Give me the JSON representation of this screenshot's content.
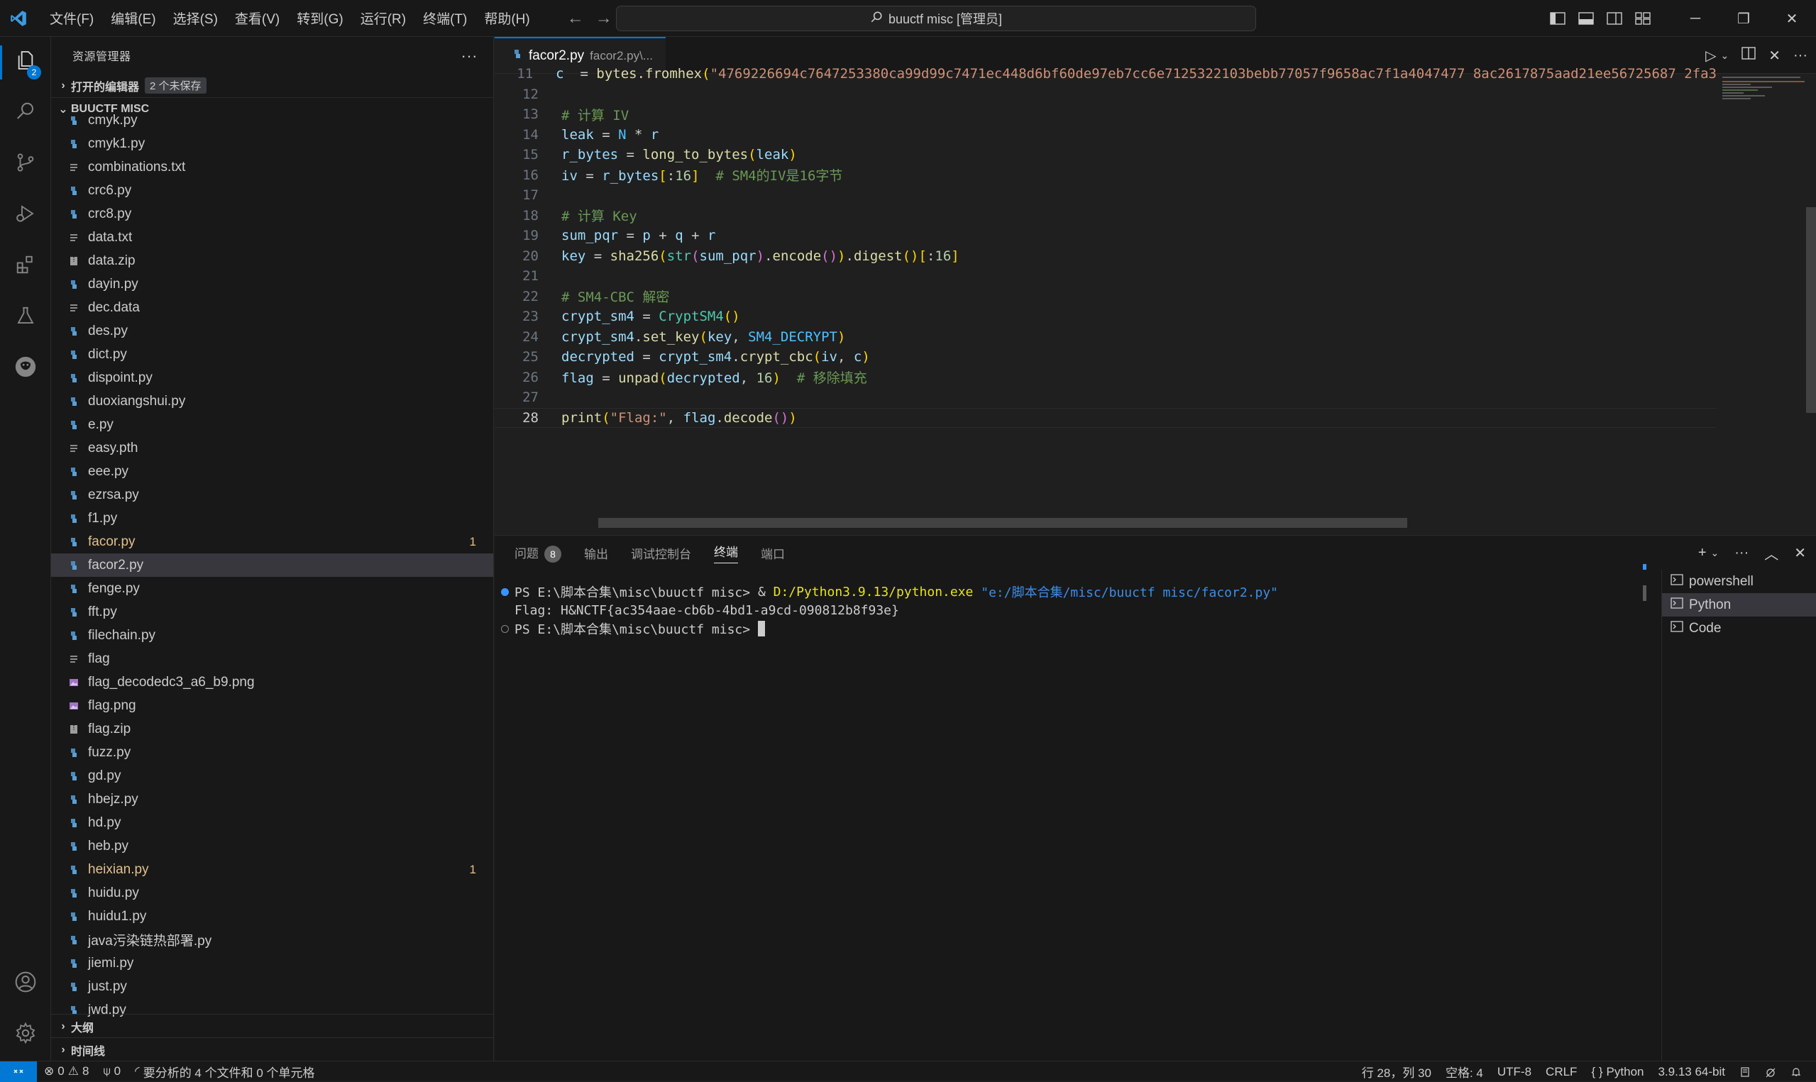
{
  "titlebar": {
    "menu": [
      "文件(F)",
      "编辑(E)",
      "选择(S)",
      "查看(V)",
      "转到(G)",
      "运行(R)",
      "终端(T)",
      "帮助(H)"
    ],
    "search": "buuctf misc [管理员]"
  },
  "activity": {
    "explorer_badge": "2"
  },
  "sidebar": {
    "title": "资源管理器",
    "open_editors": "打开的编辑器",
    "unsaved_badge": "2 个未保存",
    "folder": "BUUCTF MISC",
    "files": [
      {
        "name": "cmyk.py",
        "type": "py"
      },
      {
        "name": "cmyk1.py",
        "type": "py"
      },
      {
        "name": "combinations.txt",
        "type": "txt"
      },
      {
        "name": "crc6.py",
        "type": "py"
      },
      {
        "name": "crc8.py",
        "type": "py"
      },
      {
        "name": "data.txt",
        "type": "txt"
      },
      {
        "name": "data.zip",
        "type": "zip"
      },
      {
        "name": "dayin.py",
        "type": "py"
      },
      {
        "name": "dec.data",
        "type": "txt"
      },
      {
        "name": "des.py",
        "type": "py"
      },
      {
        "name": "dict.py",
        "type": "py"
      },
      {
        "name": "dispoint.py",
        "type": "py"
      },
      {
        "name": "duoxiangshui.py",
        "type": "py"
      },
      {
        "name": "e.py",
        "type": "py"
      },
      {
        "name": "easy.pth",
        "type": "txt"
      },
      {
        "name": "eee.py",
        "type": "py"
      },
      {
        "name": "ezrsa.py",
        "type": "py"
      },
      {
        "name": "f1.py",
        "type": "py"
      },
      {
        "name": "facor.py",
        "type": "py",
        "modified": true,
        "count": "1"
      },
      {
        "name": "facor2.py",
        "type": "py",
        "selected": true
      },
      {
        "name": "fenge.py",
        "type": "py"
      },
      {
        "name": "fft.py",
        "type": "py"
      },
      {
        "name": "filechain.py",
        "type": "py"
      },
      {
        "name": "flag",
        "type": "txt"
      },
      {
        "name": "flag_decodedc3_a6_b9.png",
        "type": "img"
      },
      {
        "name": "flag.png",
        "type": "img"
      },
      {
        "name": "flag.zip",
        "type": "zip"
      },
      {
        "name": "fuzz.py",
        "type": "py"
      },
      {
        "name": "gd.py",
        "type": "py"
      },
      {
        "name": "hbejz.py",
        "type": "py"
      },
      {
        "name": "hd.py",
        "type": "py"
      },
      {
        "name": "heb.py",
        "type": "py"
      },
      {
        "name": "heixian.py",
        "type": "py",
        "modified": true,
        "count": "1"
      },
      {
        "name": "huidu.py",
        "type": "py"
      },
      {
        "name": "huidu1.py",
        "type": "py"
      },
      {
        "name": "java污染链热部署.py",
        "type": "py"
      },
      {
        "name": "jiemi.py",
        "type": "py"
      },
      {
        "name": "just.py",
        "type": "py"
      },
      {
        "name": "jwd.py",
        "type": "py"
      }
    ],
    "outline": "大纲",
    "timeline": "时间线"
  },
  "editor": {
    "tab_name": "facor2.py",
    "tab_desc": "facor2.py\\...",
    "lines": [
      {
        "n": "11",
        "code": [
          [
            "k-var",
            "c"
          ],
          [
            "",
            "  = "
          ],
          [
            "k-fn",
            "bytes.fromhex"
          ],
          [
            "k-br",
            "("
          ],
          [
            "k-str",
            "\"4769226694c7647253380ca99d99c7471ec448d6bf60de97eb7cc6e7125322103bebb77057f9658ac7f1a4047477 8ac2617875aad21ee56725687 2fa3"
          ]
        ]
      },
      {
        "n": "12",
        "code": []
      },
      {
        "n": "13",
        "code": [
          [
            "k-cm",
            "# 计算 IV"
          ]
        ]
      },
      {
        "n": "14",
        "code": [
          [
            "k-var",
            "leak"
          ],
          [
            "",
            " = "
          ],
          [
            "k-const",
            "N"
          ],
          [
            "",
            " * "
          ],
          [
            "k-var",
            "r"
          ]
        ]
      },
      {
        "n": "15",
        "code": [
          [
            "k-var",
            "r_bytes"
          ],
          [
            "",
            " = "
          ],
          [
            "k-fn",
            "long_to_bytes"
          ],
          [
            "k-br",
            "("
          ],
          [
            "k-var",
            "leak"
          ],
          [
            "k-br",
            ")"
          ]
        ]
      },
      {
        "n": "16",
        "code": [
          [
            "k-var",
            "iv"
          ],
          [
            "",
            " = "
          ],
          [
            "k-var",
            "r_bytes"
          ],
          [
            "k-br",
            "["
          ],
          [
            "",
            ":"
          ],
          [
            "k-num",
            "16"
          ],
          [
            "k-br",
            "]"
          ],
          [
            "",
            "  "
          ],
          [
            "k-cm",
            "# SM4的IV是16字节"
          ]
        ]
      },
      {
        "n": "17",
        "code": []
      },
      {
        "n": "18",
        "code": [
          [
            "k-cm",
            "# 计算 Key"
          ]
        ]
      },
      {
        "n": "19",
        "code": [
          [
            "k-var",
            "sum_pqr"
          ],
          [
            "",
            " = "
          ],
          [
            "k-var",
            "p"
          ],
          [
            "",
            " + "
          ],
          [
            "k-var",
            "q"
          ],
          [
            "",
            " + "
          ],
          [
            "k-var",
            "r"
          ]
        ]
      },
      {
        "n": "20",
        "code": [
          [
            "k-var",
            "key"
          ],
          [
            "",
            " = "
          ],
          [
            "k-fn",
            "sha256"
          ],
          [
            "k-br",
            "("
          ],
          [
            "k-cls",
            "str"
          ],
          [
            "k-br2",
            "("
          ],
          [
            "k-var",
            "sum_pqr"
          ],
          [
            "k-br2",
            ")"
          ],
          [
            "",
            "."
          ],
          [
            "k-fn",
            "encode"
          ],
          [
            "k-br2",
            "()"
          ],
          [
            "k-br",
            ")"
          ],
          [
            "",
            "."
          ],
          [
            "k-fn",
            "digest"
          ],
          [
            "k-br",
            "()"
          ],
          [
            "k-br",
            "["
          ],
          [
            "",
            ":"
          ],
          [
            "k-num",
            "16"
          ],
          [
            "k-br",
            "]"
          ]
        ]
      },
      {
        "n": "21",
        "code": []
      },
      {
        "n": "22",
        "code": [
          [
            "k-cm",
            "# SM4-CBC 解密"
          ]
        ]
      },
      {
        "n": "23",
        "code": [
          [
            "k-var",
            "crypt_sm4"
          ],
          [
            "",
            " = "
          ],
          [
            "k-cls",
            "CryptSM4"
          ],
          [
            "k-br",
            "()"
          ]
        ]
      },
      {
        "n": "24",
        "code": [
          [
            "k-var",
            "crypt_sm4"
          ],
          [
            "",
            "."
          ],
          [
            "k-fn",
            "set_key"
          ],
          [
            "k-br",
            "("
          ],
          [
            "k-var",
            "key"
          ],
          [
            "",
            ", "
          ],
          [
            "k-const",
            "SM4_DECRYPT"
          ],
          [
            "k-br",
            ")"
          ]
        ]
      },
      {
        "n": "25",
        "code": [
          [
            "k-var",
            "decrypted"
          ],
          [
            "",
            " = "
          ],
          [
            "k-var",
            "crypt_sm4"
          ],
          [
            "",
            "."
          ],
          [
            "k-fn",
            "crypt_cbc"
          ],
          [
            "k-br",
            "("
          ],
          [
            "k-var",
            "iv"
          ],
          [
            "",
            ", "
          ],
          [
            "k-var",
            "c"
          ],
          [
            "k-br",
            ")"
          ]
        ]
      },
      {
        "n": "26",
        "code": [
          [
            "k-var",
            "flag"
          ],
          [
            "",
            " = "
          ],
          [
            "k-fn",
            "unpad"
          ],
          [
            "k-br",
            "("
          ],
          [
            "k-var",
            "decrypted"
          ],
          [
            "",
            ", "
          ],
          [
            "k-num",
            "16"
          ],
          [
            "k-br",
            ")"
          ],
          [
            "",
            "  "
          ],
          [
            "k-cm",
            "# 移除填充"
          ]
        ]
      },
      {
        "n": "27",
        "code": []
      },
      {
        "n": "28",
        "code": [
          [
            "k-fn",
            "print"
          ],
          [
            "k-br",
            "("
          ],
          [
            "k-str",
            "\"Flag:\""
          ],
          [
            "",
            ", "
          ],
          [
            "k-var",
            "flag"
          ],
          [
            "",
            "."
          ],
          [
            "k-fn",
            "decode"
          ],
          [
            "k-br2",
            "()"
          ],
          [
            "k-br",
            ")"
          ]
        ],
        "current": true
      }
    ]
  },
  "panel": {
    "tabs": [
      "问题",
      "输出",
      "调试控制台",
      "终端",
      "端口"
    ],
    "problems_badge": "8",
    "active_tab": "终端",
    "terminal": {
      "line1_prompt": "PS E:\\脚本合集\\misc\\buuctf misc> ",
      "line1_amp": "& ",
      "line1_exe": "D:/Python3.9.13/python.exe",
      "line1_arg": " \"e:/脚本合集/misc/buuctf misc/facor2.py\"",
      "line2": "Flag: H&NCTF{ac354aae-cb6b-4bd1-a9cd-090812b8f93e}",
      "line3_prompt": "PS E:\\脚本合集\\misc\\buuctf misc> "
    },
    "terminals": [
      "powershell",
      "Python",
      "Code"
    ],
    "active_terminal": "Python"
  },
  "status": {
    "errors": "0",
    "warnings": "8",
    "ports": "0",
    "analysis": "要分析的 4 个文件和 0 个单元格",
    "position": "行 28，列 30",
    "spaces": "空格: 4",
    "encoding": "UTF-8",
    "eol": "CRLF",
    "language": "Python",
    "interpreter": "3.9.13 64-bit"
  }
}
